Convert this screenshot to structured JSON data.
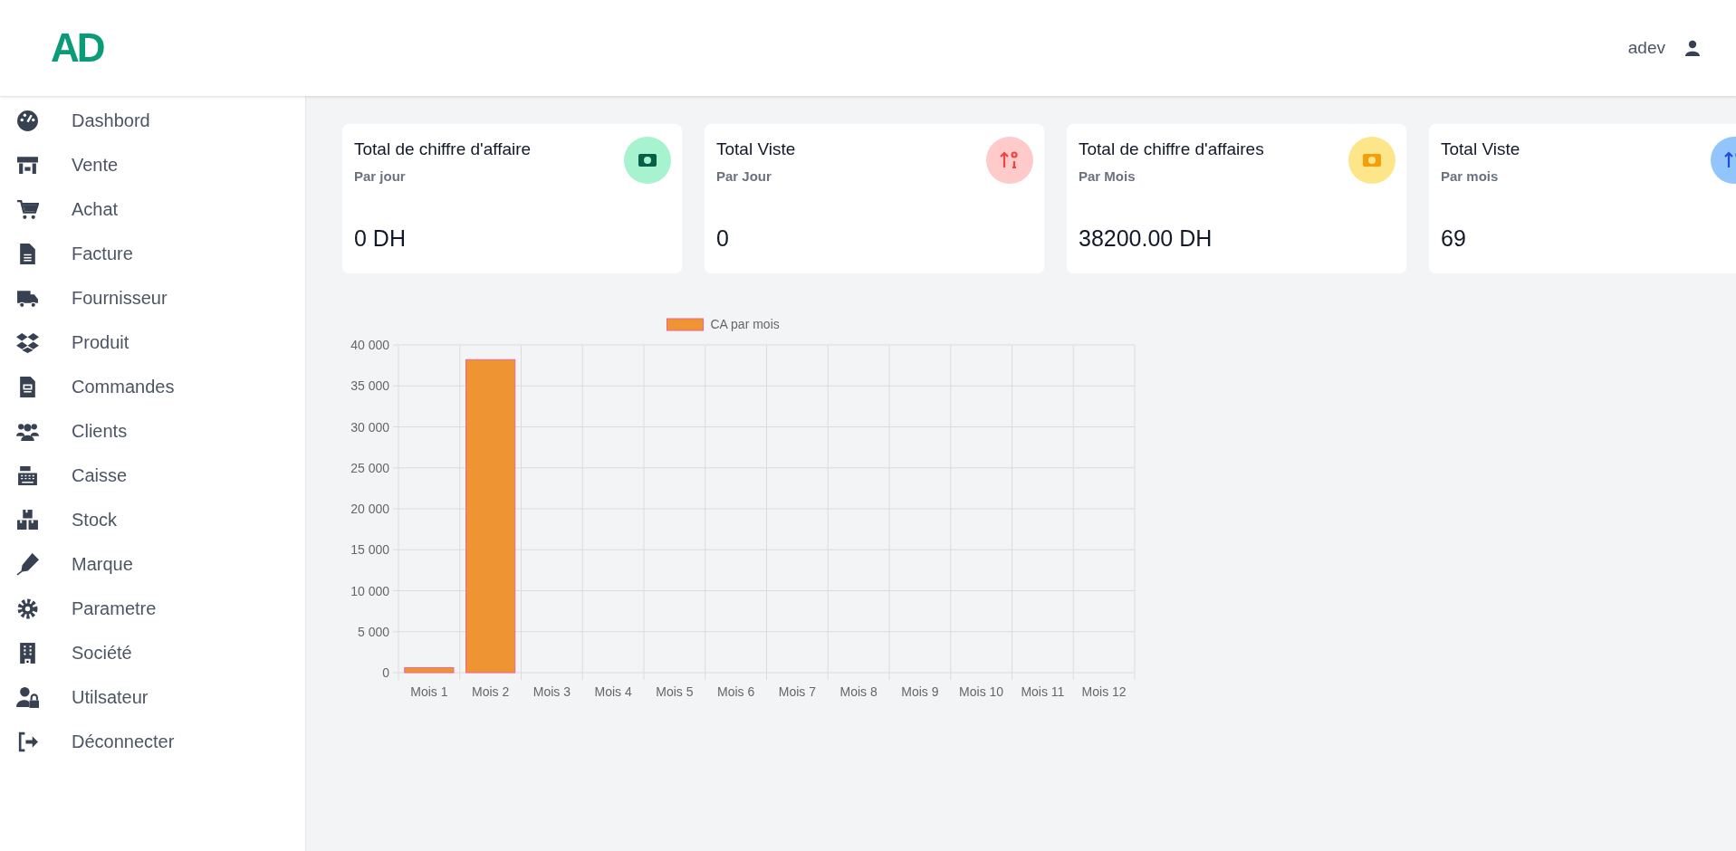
{
  "header": {
    "logo": "AD",
    "user": "adev"
  },
  "sidebar": {
    "items": [
      {
        "label": "Dashbord"
      },
      {
        "label": "Vente"
      },
      {
        "label": "Achat"
      },
      {
        "label": "Facture"
      },
      {
        "label": "Fournisseur"
      },
      {
        "label": "Produit"
      },
      {
        "label": "Commandes"
      },
      {
        "label": "Clients"
      },
      {
        "label": "Caisse"
      },
      {
        "label": "Stock"
      },
      {
        "label": "Marque"
      },
      {
        "label": "Parametre"
      },
      {
        "label": "Société"
      },
      {
        "label": "Utilsateur"
      },
      {
        "label": "Déconnecter"
      }
    ]
  },
  "cards": [
    {
      "title": "Total de chiffre d'affaire",
      "subtitle": "Par jour",
      "value": "0 DH"
    },
    {
      "title": "Total Viste",
      "subtitle": "Par Jour",
      "value": "0"
    },
    {
      "title": "Total de chiffre d'affaires",
      "subtitle": "Par Mois",
      "value": "38200.00 DH"
    },
    {
      "title": "Total Viste",
      "subtitle": "Par mois",
      "value": "69"
    }
  ],
  "chart_data": {
    "type": "bar",
    "categories": [
      "Mois 1",
      "Mois 2",
      "Mois 3",
      "Mois 4",
      "Mois 5",
      "Mois 6",
      "Mois 7",
      "Mois 8",
      "Mois 9",
      "Mois 10",
      "Mois 11",
      "Mois 12"
    ],
    "series": [
      {
        "name": "CA par mois",
        "color": "#ef9433",
        "values": [
          600,
          38200,
          0,
          0,
          0,
          0,
          0,
          0,
          0,
          0,
          0,
          0
        ]
      }
    ],
    "ylim": [
      0,
      40000
    ],
    "grid": true,
    "yticks": [
      {
        "value": 0,
        "label": "0"
      },
      {
        "value": 5000,
        "label": "5 000"
      },
      {
        "value": 10000,
        "label": "10 000"
      },
      {
        "value": 15000,
        "label": "15 000"
      },
      {
        "value": 20000,
        "label": "20 000"
      },
      {
        "value": 25000,
        "label": "25 000"
      },
      {
        "value": 30000,
        "label": "30 000"
      },
      {
        "value": 35000,
        "label": "35 000"
      },
      {
        "value": 40000,
        "label": "40 000"
      }
    ]
  }
}
